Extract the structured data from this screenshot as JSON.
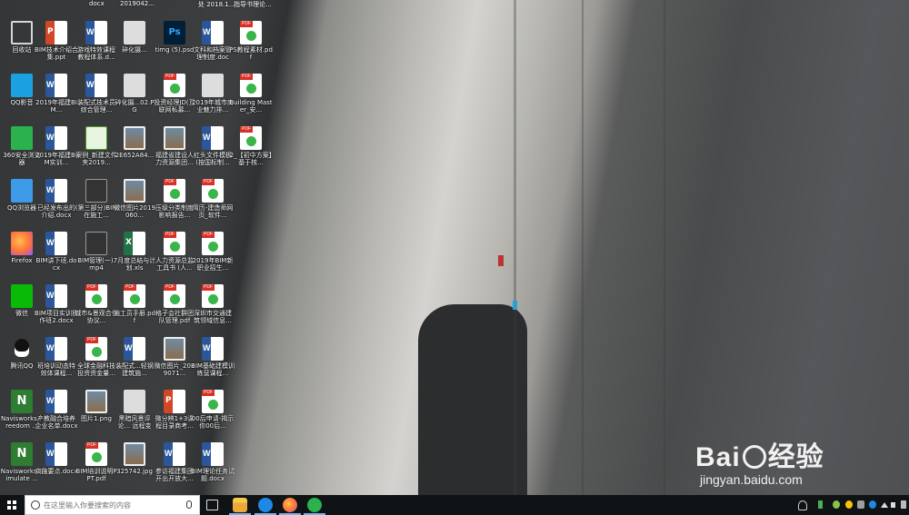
{
  "desktop": {
    "top_strip": [
      "docx",
      "2019042...",
      "处 2018.1...",
      "指导书理论..."
    ],
    "icons": [
      {
        "id": "recycle-bin",
        "label": "回收站",
        "type": "recycle",
        "icon": "recycle-bin-icon"
      },
      {
        "id": "qq-video",
        "label": "QQ影音",
        "type": "qqv",
        "icon": "qq-video-icon"
      },
      {
        "id": "360-browser",
        "label": "360安全浏览器",
        "type": "360",
        "icon": "360-browser-icon"
      },
      {
        "id": "qq-browser",
        "label": "QQ浏览器",
        "type": "qqb",
        "icon": "qq-browser-icon"
      },
      {
        "id": "firefox",
        "label": "Firefox",
        "type": "ff",
        "icon": "firefox-icon"
      },
      {
        "id": "wechat",
        "label": "微信",
        "type": "wx",
        "icon": "wechat-icon"
      },
      {
        "id": "tencent-qq",
        "label": "腾讯QQ",
        "type": "qq",
        "icon": "qq-penguin-icon"
      },
      {
        "id": "navisworks-freedom",
        "label": "Navisworks Freedom ...",
        "type": "nav",
        "icon": "navisworks-icon"
      },
      {
        "id": "navisworks-simulate",
        "label": "Navisworks Simulate ...",
        "type": "nav",
        "icon": "navisworks-icon"
      },
      {
        "id": "c2r1",
        "label": "BIM技术介绍合集.ppt",
        "type": "ppt",
        "icon": "powerpoint-icon"
      },
      {
        "id": "c2r2",
        "label": "2019年福建BIM...",
        "type": "word",
        "icon": "word-icon"
      },
      {
        "id": "c2r3",
        "label": "2019年福建BIM实训...",
        "type": "word",
        "icon": "word-icon"
      },
      {
        "id": "c2r4",
        "label": "已经发布出的介绍.docx",
        "type": "word",
        "icon": "word-icon"
      },
      {
        "id": "c2r5",
        "label": "BIM讲下班.docx",
        "type": "word",
        "icon": "word-icon"
      },
      {
        "id": "c2r6",
        "label": "BIM项目实训操作班2.docx",
        "type": "word",
        "icon": "word-icon"
      },
      {
        "id": "c2r7",
        "label": "班培训动态特效体课程...",
        "type": "word",
        "icon": "word-icon"
      },
      {
        "id": "c2r8",
        "label": "产教融合培养企业名单.docx",
        "type": "word",
        "icon": "word-icon"
      },
      {
        "id": "c2r9",
        "label": "实施要点.docx",
        "type": "word",
        "icon": "word-icon"
      },
      {
        "id": "c3r1",
        "label": "游戏特效课程教程体系.d...",
        "type": "word",
        "icon": "word-icon"
      },
      {
        "id": "c3r2",
        "label": "装配式技术员综合管理...",
        "type": "word",
        "icon": "word-icon"
      },
      {
        "id": "c3r3",
        "label": "案例_新建文件夹2019...",
        "type": "mkv",
        "icon": "video-file-icon"
      },
      {
        "id": "c3r4",
        "label": "(第三部分)BIM在施工...",
        "type": "mp4",
        "icon": "video-file-icon"
      },
      {
        "id": "c3r5",
        "label": "BIM管理(一).mp4",
        "type": "mp4",
        "icon": "video-file-icon"
      },
      {
        "id": "c3r6",
        "label": "城市&景观合作协议...",
        "type": "pdf",
        "icon": "pdf-icon"
      },
      {
        "id": "c3r7",
        "label": "全球金融科技投资资金量...",
        "type": "pdf",
        "icon": "pdf-icon"
      },
      {
        "id": "c3r8",
        "label": "图片1.png",
        "type": "img",
        "icon": "image-file-icon"
      },
      {
        "id": "c3r9",
        "label": "BIM培训说明PPT.pdf",
        "type": "pdf",
        "icon": "pdf-icon"
      },
      {
        "id": "c4r1",
        "label": "碎化摄...",
        "type": "gen",
        "icon": "file-icon"
      },
      {
        "id": "c4r2",
        "label": "碎化摄...02.PG",
        "type": "gen",
        "icon": "file-icon"
      },
      {
        "id": "c4r3",
        "label": "2E652A84...",
        "type": "img",
        "icon": "image-file-icon"
      },
      {
        "id": "c4r4",
        "label": "微信图片2019060...",
        "type": "img",
        "icon": "image-file-icon"
      },
      {
        "id": "c4r5",
        "label": "7月度总结与计划.xls",
        "type": "xls",
        "icon": "excel-icon"
      },
      {
        "id": "c4r6",
        "label": "施工员手册.pdf",
        "type": "pdf",
        "icon": "pdf-icon"
      },
      {
        "id": "c4r7",
        "label": "装配式...轻钢建筑施...",
        "type": "word",
        "icon": "word-icon"
      },
      {
        "id": "c4r8",
        "label": "黑暗风景评论... 远程变更...",
        "type": "gen",
        "icon": "file-icon"
      },
      {
        "id": "c4r9",
        "label": "325742.jpg",
        "type": "img",
        "icon": "image-file-icon"
      },
      {
        "id": "c5r1",
        "label": "timg (5).psd",
        "type": "ps",
        "icon": "photoshop-icon"
      },
      {
        "id": "c5r2",
        "label": "投资经理JD(互联网私募...",
        "type": "pdf",
        "icon": "pdf-icon"
      },
      {
        "id": "c5r3",
        "label": "福建省建设人力资源集团...",
        "type": "img",
        "icon": "image-file-icon"
      },
      {
        "id": "c5r4",
        "label": "压级分类制度影响报告...",
        "type": "pdf",
        "icon": "pdf-icon"
      },
      {
        "id": "c5r5",
        "label": "人力资源总监工具书 (人...",
        "type": "pdf",
        "icon": "pdf-icon"
      },
      {
        "id": "c5r6",
        "label": "格子会社群团队管理.pdf",
        "type": "pdf",
        "icon": "pdf-icon"
      },
      {
        "id": "c5r7",
        "label": "微信图片_2019071...",
        "type": "img",
        "icon": "image-file-icon"
      },
      {
        "id": "c5r8",
        "label": "微分辨1+3课程目录商考...",
        "type": "ppt",
        "icon": "powerpoint-icon"
      },
      {
        "id": "c5r9",
        "label": "参访福建集团开出开放大...",
        "type": "word",
        "icon": "word-icon"
      },
      {
        "id": "c6r1",
        "label": "文科和档案管理制度.doc",
        "type": "word",
        "icon": "word-icon"
      },
      {
        "id": "c6r2",
        "label": "2019年城市商业魅力排...",
        "type": "gen",
        "icon": "file-icon"
      },
      {
        "id": "c6r3",
        "label": "红头文件模板(按国标制...",
        "type": "word",
        "icon": "word-icon"
      },
      {
        "id": "c6r4",
        "label": "简历-建造师网页_软件...",
        "type": "pdf",
        "icon": "pdf-icon"
      },
      {
        "id": "c6r5",
        "label": "2019年BIM新职业招生...",
        "type": "pdf",
        "icon": "pdf-icon"
      },
      {
        "id": "c6r6",
        "label": "深圳市交通建筑领域信息...",
        "type": "pdf",
        "icon": "pdf-icon"
      },
      {
        "id": "c6r7",
        "label": "BIM基础建模训练营课程...",
        "type": "word",
        "icon": "word-icon"
      },
      {
        "id": "c6r8",
        "label": "00后申请-揭示你00后...",
        "type": "pdf",
        "icon": "pdf-icon"
      },
      {
        "id": "c6r9",
        "label": "BIM理论任务试题.docx",
        "type": "word",
        "icon": "word-icon"
      },
      {
        "id": "c7r1",
        "label": "PS教程素材.pdf",
        "type": "pdf",
        "icon": "pdf-icon"
      },
      {
        "id": "c7r2",
        "label": "Building Master_安...",
        "type": "pdf",
        "icon": "pdf-icon"
      },
      {
        "id": "c7r3",
        "label": "2_【初中方案】基于核...",
        "type": "pdf",
        "icon": "pdf-icon"
      }
    ]
  },
  "watermark": {
    "brand": "Bai",
    "brand_suffix": "经验",
    "url": "jingyan.baidu.com"
  },
  "taskbar": {
    "search_placeholder": "在这里输入你要搜索的内容",
    "pinned": [
      {
        "name": "task-view-icon"
      },
      {
        "name": "file-explorer-icon"
      },
      {
        "name": "qq-browser-taskbar-icon"
      },
      {
        "name": "firefox-taskbar-icon"
      },
      {
        "name": "360-browser-taskbar-icon"
      }
    ],
    "tray": [
      "people-icon",
      "battery-icon",
      "green-app-icon",
      "tray-app-icon",
      "security-icon",
      "bluetooth-icon",
      "network-icon",
      "speaker-icon",
      "ime-icon"
    ]
  },
  "colors": {
    "taskbar_bg": "#101316",
    "word_blue": "#2b579a",
    "pdf_red": "#d93025",
    "pdf_green": "#39b54a"
  }
}
